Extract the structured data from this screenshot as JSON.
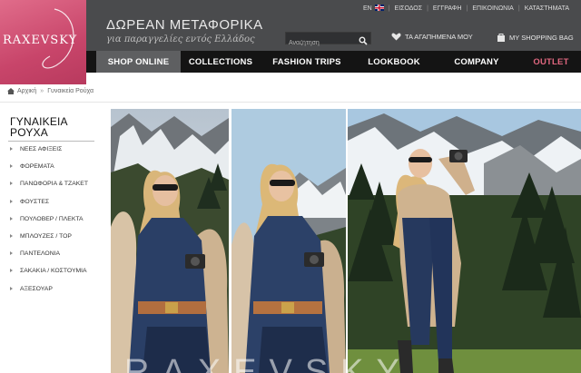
{
  "brand": {
    "name": "RAXEVSKY",
    "accent": "#d4577a"
  },
  "promo": {
    "title": "ΔΩΡΕΑΝ ΜΕΤΑΦΟΡΙΚΑ",
    "subtitle": "για παραγγελίες εντός Ελλάδος"
  },
  "toplinks": {
    "lang": "EN",
    "login": "ΕΙΣΟΔΟΣ",
    "register": "ΕΓΓΡΑΦΗ",
    "contact": "ΕΠΙΚΟΙΝΩΝΙΑ",
    "stores": "ΚΑΤΑΣΤΗΜΑΤΑ"
  },
  "search": {
    "placeholder": "Αναζήτηση",
    "icon": "search-icon"
  },
  "favorites": {
    "label": "ΤΑ ΑΓΑΠΗΜΕΝΑ ΜΟΥ",
    "icon": "heart-icon"
  },
  "bag": {
    "label": "MY SHOPPING BAG",
    "icon": "shopping-bag-icon"
  },
  "nav": {
    "items": [
      {
        "label": "SHOP ONLINE"
      },
      {
        "label": "COLLECTIONS"
      },
      {
        "label": "FASHION TRIPS"
      },
      {
        "label": "LOOKBOOK"
      },
      {
        "label": "COMPANY"
      },
      {
        "label": "OUTLET"
      }
    ],
    "active": "SHOP ONLINE",
    "outlet_color": "#e0677f"
  },
  "breadcrumb": {
    "home": "Αρχική",
    "current": "Γυναικεία Ρούχα"
  },
  "sidebar": {
    "title_line1": "ΓΥΝΑΙΚΕΙΑ",
    "title_line2": "ΡΟΥΧΑ",
    "items": [
      "ΝΕΕΣ ΑΦΙΞΕΙΣ",
      "ΦΟΡΕΜΑΤΑ",
      "ΠΑΝΩΦΟΡΙΑ & ΤΖΑΚΕΤ",
      "ΦΟΥΣΤΕΣ",
      "ΠΟΥΛΟΒΕΡ / ΠΛΕΚΤΑ",
      "ΜΠΛΟΥΖΕΣ / TOP",
      "ΠΑΝΤΕΛΟΝΙΑ",
      "ΣΑΚΑΚΙΑ / ΚΟΣΤΟΥΜΙΑ",
      "ΑΞΕΣΟΥΑΡ"
    ]
  }
}
